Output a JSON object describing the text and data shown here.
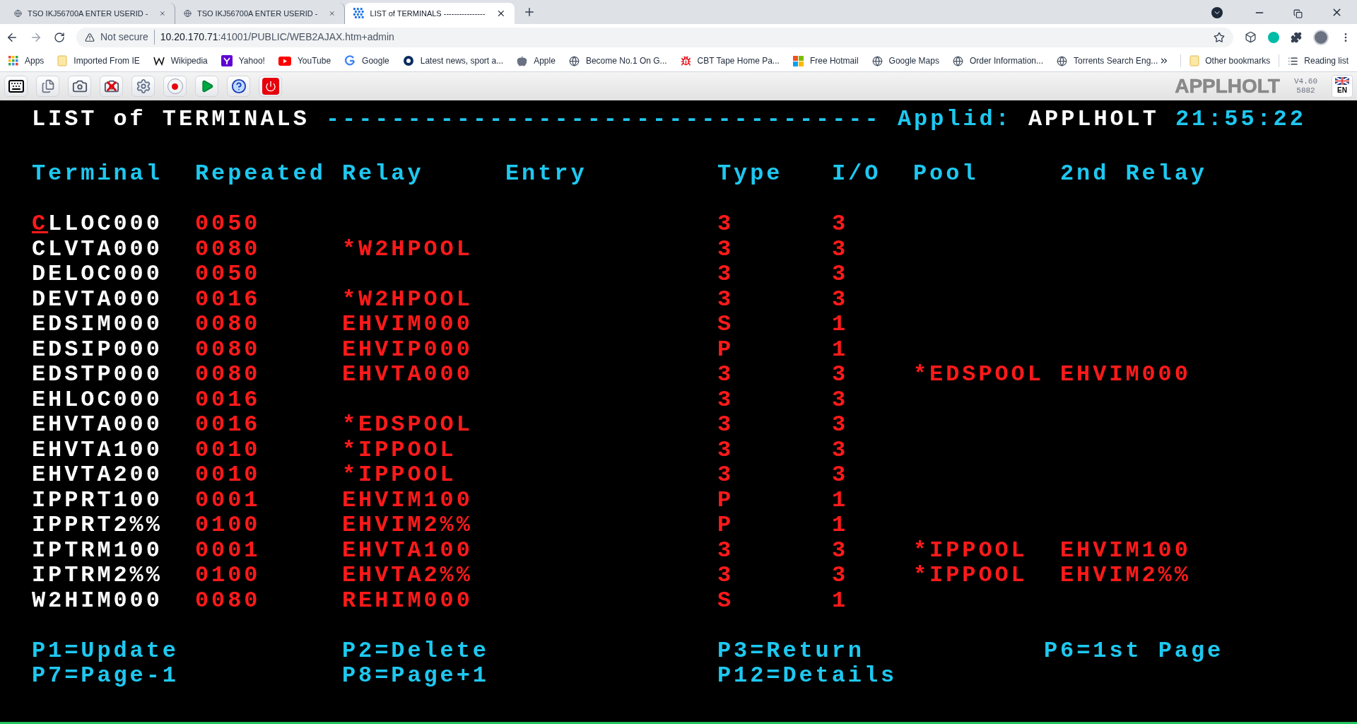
{
  "browser": {
    "tabs": [
      {
        "title": "TSO IKJ56700A ENTER USERID -",
        "kind": "globe",
        "selected": false
      },
      {
        "title": "TSO IKJ56700A ENTER USERID -",
        "kind": "globe",
        "selected": false
      },
      {
        "title": "LIST of TERMINALS ----------------",
        "kind": "grid",
        "selected": true
      }
    ],
    "security": "Not secure",
    "url_host": "10.20.170.71",
    "url_path": ":41001/PUBLIC/WEB2AJAX.htm+admin",
    "bookmarks": [
      {
        "label": "Apps",
        "kind": "apps"
      },
      {
        "label": "Imported From IE",
        "kind": "folder"
      },
      {
        "label": "Wikipedia",
        "kind": "wiki"
      },
      {
        "label": "Yahoo!",
        "kind": "yahoo"
      },
      {
        "label": "YouTube",
        "kind": "youtube"
      },
      {
        "label": "Google",
        "kind": "google"
      },
      {
        "label": "Latest news, sport a...",
        "kind": "news"
      },
      {
        "label": "Apple",
        "kind": "apple"
      },
      {
        "label": "Become No.1 On G...",
        "kind": "globe"
      },
      {
        "label": "CBT Tape Home Pa...",
        "kind": "bug"
      },
      {
        "label": "Free Hotmail",
        "kind": "windows"
      },
      {
        "label": "Google Maps",
        "kind": "globe"
      },
      {
        "label": "Order Information...",
        "kind": "globe"
      },
      {
        "label": "Torrents Search Eng...",
        "kind": "globe"
      }
    ],
    "other_bookmarks": "Other bookmarks",
    "reading_list": "Reading list"
  },
  "toolbar": {
    "tools": [
      {
        "kind": "keyboard"
      },
      {
        "kind": "copy"
      },
      {
        "kind": "camera"
      },
      {
        "kind": "camera-off"
      },
      {
        "kind": "settings"
      },
      {
        "kind": "record"
      },
      {
        "kind": "play"
      },
      {
        "kind": "help"
      },
      {
        "kind": "power"
      }
    ],
    "applid_logo": "APPLHOLT",
    "version": "V4.60",
    "build": "5882",
    "language": "EN"
  },
  "screen": {
    "title": "LIST of TERMINALS",
    "dashes": "----------------------------------",
    "applid_label": "Applid:",
    "applid": "APPLHOLT",
    "time": "21:55:22",
    "columns": [
      "Terminal",
      "Repeated",
      "Relay",
      "Entry",
      "Type",
      "I/O",
      "Pool",
      "2nd Relay"
    ],
    "rows": [
      {
        "terminal": "CLLOC000",
        "repeated": "0050",
        "type": "3",
        "io": "3",
        "cursor": true
      },
      {
        "terminal": "CLVTA000",
        "repeated": "0080",
        "relay": "*W2HPOOL",
        "type": "3",
        "io": "3",
        "cursor": false
      },
      {
        "terminal": "DELOC000",
        "repeated": "0050",
        "type": "3",
        "io": "3",
        "cursor": false
      },
      {
        "terminal": "DEVTA000",
        "repeated": "0016",
        "relay": "*W2HPOOL",
        "type": "3",
        "io": "3",
        "cursor": false
      },
      {
        "terminal": "EDSIM000",
        "repeated": "0080",
        "relay": "EHVIM000",
        "type": "S",
        "io": "1",
        "cursor": false
      },
      {
        "terminal": "EDSIP000",
        "repeated": "0080",
        "relay": "EHVIP000",
        "type": "P",
        "io": "1",
        "cursor": false
      },
      {
        "terminal": "EDSTP000",
        "repeated": "0080",
        "relay": "EHVTA000",
        "type": "3",
        "io": "3",
        "pool": "*EDSPOOL",
        "relay2": "EHVIM000",
        "cursor": false
      },
      {
        "terminal": "EHLOC000",
        "repeated": "0016",
        "type": "3",
        "io": "3",
        "cursor": false
      },
      {
        "terminal": "EHVTA000",
        "repeated": "0016",
        "relay": "*EDSPOOL",
        "type": "3",
        "io": "3",
        "cursor": false
      },
      {
        "terminal": "EHVTA100",
        "repeated": "0010",
        "relay": "*IPPOOL",
        "type": "3",
        "io": "3",
        "cursor": false
      },
      {
        "terminal": "EHVTA200",
        "repeated": "0010",
        "relay": "*IPPOOL",
        "type": "3",
        "io": "3",
        "cursor": false
      },
      {
        "terminal": "IPPRT100",
        "repeated": "0001",
        "relay": "EHVIM100",
        "type": "P",
        "io": "1",
        "cursor": false
      },
      {
        "terminal": "IPPRT2%%",
        "repeated": "0100",
        "relay": "EHVIM2%%",
        "type": "P",
        "io": "1",
        "cursor": false
      },
      {
        "terminal": "IPTRM100",
        "repeated": "0001",
        "relay": "EHVTA100",
        "type": "3",
        "io": "3",
        "pool": "*IPPOOL",
        "relay2": "EHVIM100",
        "cursor": false
      },
      {
        "terminal": "IPTRM2%%",
        "repeated": "0100",
        "relay": "EHVTA2%%",
        "type": "3",
        "io": "3",
        "pool": "*IPPOOL",
        "relay2": "EHVIM2%%",
        "cursor": false
      },
      {
        "terminal": "W2HIM000",
        "repeated": "0080",
        "relay": "REHIM000",
        "type": "S",
        "io": "1",
        "cursor": false
      }
    ],
    "pf_keys": [
      [
        "P1=Update",
        "P2=Delete",
        "P3=Return",
        "P6=1st Page"
      ],
      [
        "P7=Page-1",
        "P8=Page+1",
        "P12=Details"
      ]
    ]
  }
}
